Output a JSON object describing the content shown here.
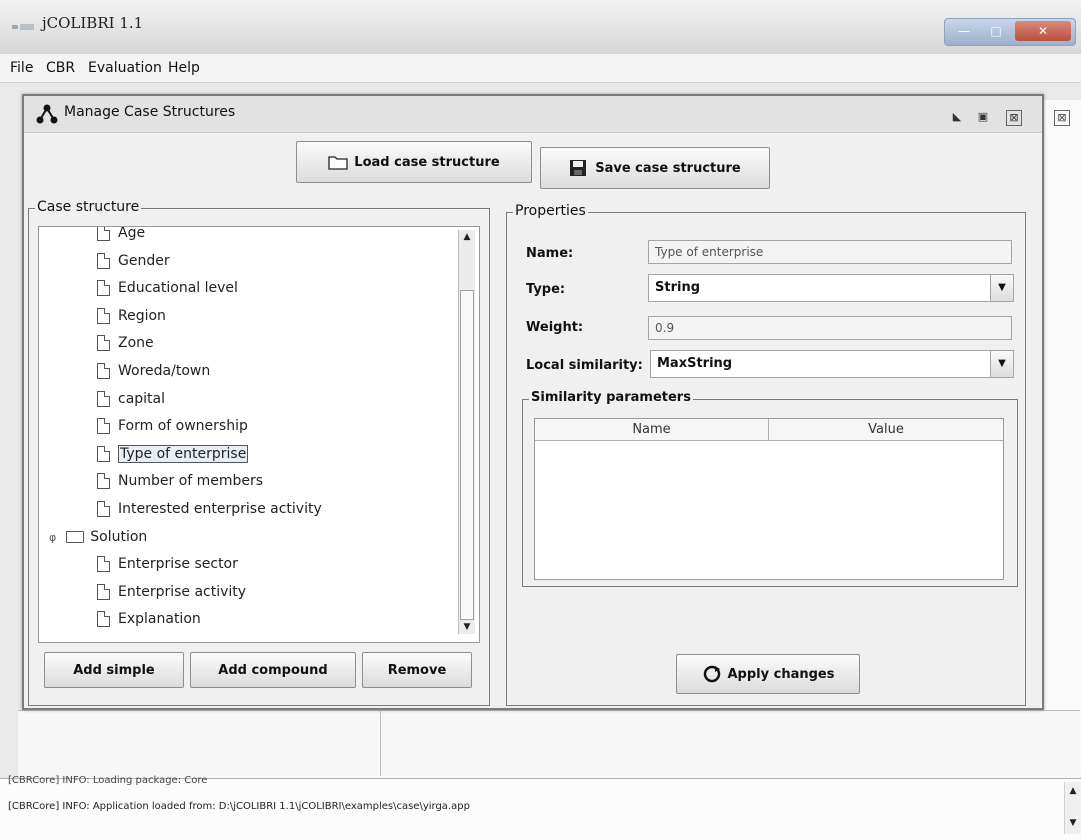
{
  "window": {
    "title": "jCOLIBRI 1.1"
  },
  "menubar": {
    "items": [
      "File",
      "CBR",
      "Evaluation",
      "Help"
    ]
  },
  "dialog": {
    "title": "Manage Case Structures",
    "load_label": "Load case structure",
    "save_label": "Save case structure"
  },
  "case_structure": {
    "legend": "Case structure",
    "items": [
      {
        "label": "Age",
        "type": "leaf"
      },
      {
        "label": "Gender",
        "type": "leaf"
      },
      {
        "label": "Educational level",
        "type": "leaf"
      },
      {
        "label": "Region",
        "type": "leaf"
      },
      {
        "label": "Zone",
        "type": "leaf"
      },
      {
        "label": "Woreda/town",
        "type": "leaf"
      },
      {
        "label": "capital",
        "type": "leaf"
      },
      {
        "label": "Form of ownership",
        "type": "leaf"
      },
      {
        "label": "Type of enterprise",
        "type": "leaf",
        "selected": true
      },
      {
        "label": "Number of members",
        "type": "leaf"
      },
      {
        "label": "Interested enterprise activity",
        "type": "leaf"
      },
      {
        "label": "Solution",
        "type": "folder"
      },
      {
        "label": "Enterprise sector",
        "type": "leaf"
      },
      {
        "label": "Enterprise activity",
        "type": "leaf"
      },
      {
        "label": "Explanation",
        "type": "leaf"
      }
    ],
    "add_simple_label": "Add simple",
    "add_compound_label": "Add compound",
    "remove_label": "Remove"
  },
  "properties": {
    "legend": "Properties",
    "name_label": "Name:",
    "name_value": "Type of enterprise",
    "type_label": "Type:",
    "type_value": "String",
    "weight_label": "Weight:",
    "weight_value": "0.9",
    "local_similarity_label": "Local similarity:",
    "local_similarity_value": "MaxString",
    "similarity_params_legend": "Similarity parameters",
    "table_headers": [
      "Name",
      "Value"
    ],
    "apply_label": "Apply changes"
  },
  "log": {
    "lines": [
      "[CBRCore] INFO: Loading package: Core",
      "[CBRCore] INFO: Application loaded from: D:\\jCOLIBRI 1.1\\jCOLIBRI\\examples\\case\\yirga.app"
    ]
  }
}
